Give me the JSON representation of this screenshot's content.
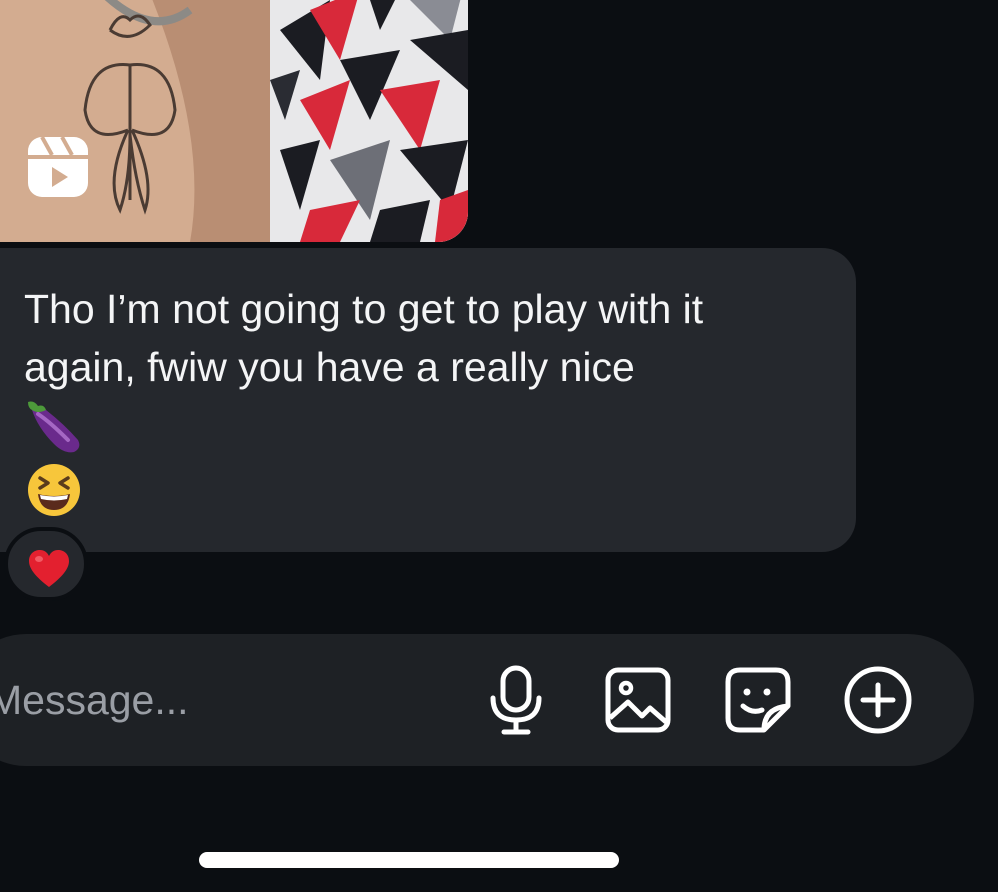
{
  "shared_reel": {
    "badge_icon": "reels-icon"
  },
  "message": {
    "text": "Tho I’m not going to get to play with it again, fwiw you have a really nice",
    "emoji_1": "eggplant-emoji",
    "emoji_2": "grinning-squinting-face-emoji"
  },
  "reaction": {
    "emoji": "red-heart-emoji"
  },
  "composer": {
    "placeholder": "Message...",
    "value": "",
    "icons": [
      "microphone-icon",
      "gallery-icon",
      "sticker-icon",
      "add-icon"
    ]
  },
  "colors": {
    "background": "#0b0e12",
    "bubble": "#25282d",
    "composer": "#1e2125",
    "text": "#f4f5f6",
    "placeholder": "#9a9ea5"
  }
}
